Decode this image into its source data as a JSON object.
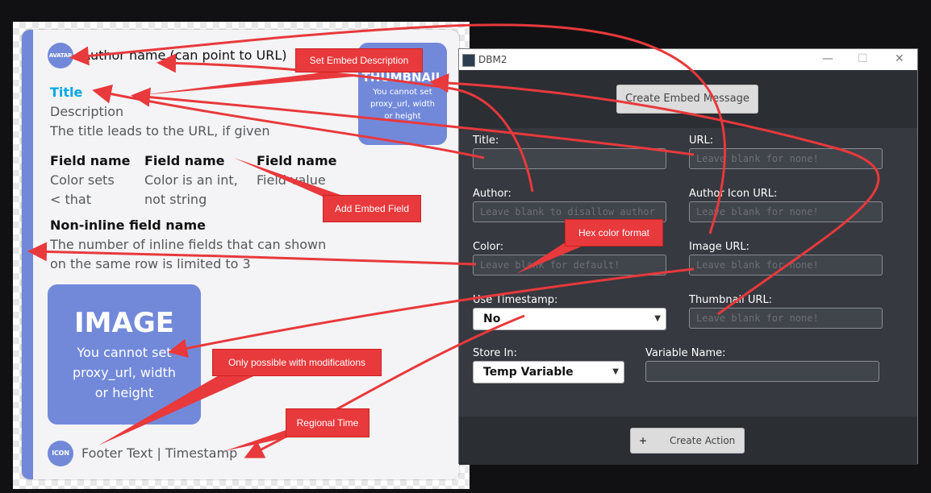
{
  "embed_preview": {
    "avatar_label": "AVATAR",
    "author_text": "Author name (can point to URL)",
    "thumbnail": {
      "title": "THUMBNAIL",
      "text": "You cannot set proxy_url, width or height"
    },
    "title": "Title",
    "description": "Description",
    "title_note": "The title leads to the URL, if given",
    "fields": [
      {
        "name": "Field name",
        "value_line1": "Color sets",
        "value_line2": "< that"
      },
      {
        "name": "Field name",
        "value_line1": "Color is an int,",
        "value_line2": "not string"
      },
      {
        "name": "Field name",
        "value_line1": "Field value",
        "value_line2": ""
      }
    ],
    "noninline_field": {
      "name": "Non-inline field name",
      "value_line1": "The number of inline fields that can shown",
      "value_line2": "on the same row is limited to 3"
    },
    "image": {
      "title": "IMAGE",
      "line1": "You cannot set",
      "line2": "proxy_url, width",
      "line3": "or height"
    },
    "footer_icon_label": "ICON",
    "footer_text": "Footer Text | Timestamp",
    "accent_color": "#7289da"
  },
  "window": {
    "title": "DBM2",
    "controls": {
      "minimize": "—",
      "maximize": "☐",
      "close": "✕"
    },
    "create_embed_button": "Create Embed Message",
    "fields": {
      "title": {
        "label": "Title:",
        "value": "",
        "placeholder": ""
      },
      "url": {
        "label": "URL:",
        "placeholder": "Leave blank for none!"
      },
      "author": {
        "label": "Author:",
        "placeholder": "Leave blank to disallow author"
      },
      "author_icon_url": {
        "label": "Author Icon URL:",
        "placeholder": "Leave blank for none!"
      },
      "color": {
        "label": "Color:",
        "placeholder": "Leave blank for default!"
      },
      "image_url": {
        "label": "Image URL:",
        "placeholder": "Leave blank for none!"
      },
      "use_timestamp": {
        "label": "Use Timestamp:",
        "selected": "No"
      },
      "thumbnail_url": {
        "label": "Thumbnail URL:",
        "placeholder": "Leave blank for none!"
      },
      "store_in": {
        "label": "Store In:",
        "selected": "Temp Variable"
      },
      "variable_name": {
        "label": "Variable Name:",
        "value": ""
      }
    },
    "create_action_button": {
      "icon": "+",
      "label": "Create Action"
    }
  },
  "callouts": {
    "set_embed_description": "Set Embed Description",
    "add_embed_field": "Add Embed Field",
    "hex_color_format": "Hex color format",
    "only_possible": "Only possible with modifications",
    "regional_time": "Regional Time"
  },
  "colors": {
    "callout_red": "#e8393c",
    "window_bg": "#36393f",
    "embed_accent": "#7289da"
  }
}
